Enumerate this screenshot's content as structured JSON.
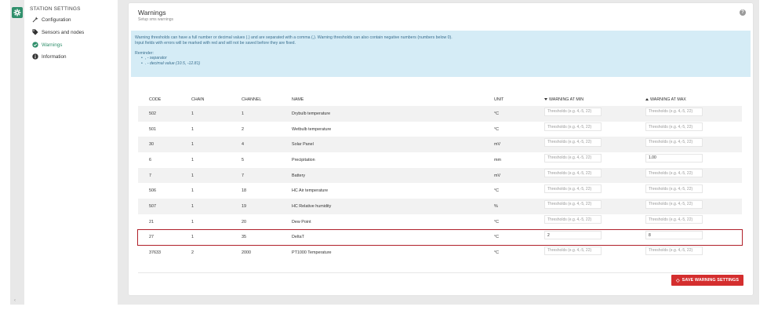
{
  "rail": {
    "icon": "gear-icon",
    "chevron": "‹"
  },
  "sidebar": {
    "title": "STATION SETTINGS",
    "items": [
      {
        "label": "Configuration",
        "icon": "wrench-icon",
        "active": false
      },
      {
        "label": "Sensors and nodes",
        "icon": "tag-icon",
        "active": false
      },
      {
        "label": "Warnings",
        "icon": "check-circle-icon",
        "active": true
      },
      {
        "label": "Information",
        "icon": "info-icon",
        "active": false
      }
    ]
  },
  "page": {
    "title": "Warnings",
    "subtitle": "Setup sms warnings",
    "help": "?"
  },
  "info": {
    "line1": "Warning thresholds can have a full number or decimal values (.) and are separated with a comma (,). Warning thresholds can also contain negative numbers (numbers below 0).",
    "line2": "Input fields with errors will be marked with red and will not be saved before they are fixed.",
    "reminder": "Reminder:",
    "bullet1": ", - separator",
    "bullet2": ". - decimal value (10.5, -12.81)"
  },
  "table": {
    "headers": {
      "code": "CODE",
      "chain": "CHAIN",
      "channel": "CHANNEL",
      "name": "NAME",
      "unit": "UNIT",
      "min": "WARNING AT MIN",
      "max": "WARNING AT MAX"
    },
    "placeholder": "Thresholds (e.g. 4,-5, 22)",
    "rows": [
      {
        "code": "502",
        "chain": "1",
        "channel": "1",
        "name": "Drybulb temperature",
        "unit": "°C",
        "min": "",
        "max": ""
      },
      {
        "code": "501",
        "chain": "1",
        "channel": "2",
        "name": "Wetbulb temperature",
        "unit": "°C",
        "min": "",
        "max": ""
      },
      {
        "code": "30",
        "chain": "1",
        "channel": "4",
        "name": "Solar Panel",
        "unit": "mV",
        "min": "",
        "max": ""
      },
      {
        "code": "6",
        "chain": "1",
        "channel": "5",
        "name": "Precipitation",
        "unit": "mm",
        "min": "",
        "max": "1.00"
      },
      {
        "code": "7",
        "chain": "1",
        "channel": "7",
        "name": "Battery",
        "unit": "mV",
        "min": "",
        "max": ""
      },
      {
        "code": "506",
        "chain": "1",
        "channel": "18",
        "name": "HC Air temperature",
        "unit": "°C",
        "min": "",
        "max": ""
      },
      {
        "code": "507",
        "chain": "1",
        "channel": "19",
        "name": "HC Relative humidity",
        "unit": "%",
        "min": "",
        "max": ""
      },
      {
        "code": "21",
        "chain": "1",
        "channel": "20",
        "name": "Dew Point",
        "unit": "°C",
        "min": "",
        "max": ""
      },
      {
        "code": "27",
        "chain": "1",
        "channel": "35",
        "name": "DeltaT",
        "unit": "°C",
        "min": "2",
        "max": "8"
      },
      {
        "code": "37633",
        "chain": "2",
        "channel": "2000",
        "name": "PT1000 Temperature",
        "unit": "°C",
        "min": "",
        "max": ""
      }
    ]
  },
  "actions": {
    "save_label": "SAVE WARNING SETTINGS",
    "save_icon": "save-icon"
  },
  "colors": {
    "accent": "#2f8f6b",
    "danger": "#d42e2e",
    "info_bg": "#d5ecf6",
    "highlight_border": "#b0202a"
  }
}
